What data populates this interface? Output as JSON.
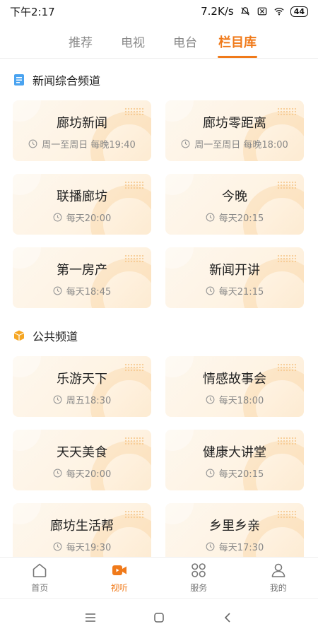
{
  "status_bar": {
    "time": "下午2:17",
    "network_speed": "7.2K/s",
    "battery": "44"
  },
  "top_tabs": [
    {
      "label": "推荐",
      "active": false
    },
    {
      "label": "电视",
      "active": false
    },
    {
      "label": "电台",
      "active": false
    },
    {
      "label": "栏目库",
      "active": true
    }
  ],
  "sections": [
    {
      "title": "新闻综合频道",
      "icon": "document-icon",
      "programs": [
        {
          "name": "廊坊新闻",
          "schedule": "周一至周日 每晚19:40"
        },
        {
          "name": "廊坊零距离",
          "schedule": "周一至周日 每晚18:00"
        },
        {
          "name": "联播廊坊",
          "schedule": "每天20:00"
        },
        {
          "name": "今晚",
          "schedule": "每天20:15"
        },
        {
          "name": "第一房产",
          "schedule": "每天18:45"
        },
        {
          "name": "新闻开讲",
          "schedule": "每天21:15"
        }
      ]
    },
    {
      "title": "公共频道",
      "icon": "box-icon",
      "programs": [
        {
          "name": "乐游天下",
          "schedule": "周五18:30"
        },
        {
          "name": "情感故事会",
          "schedule": "每天18:00"
        },
        {
          "name": "天天美食",
          "schedule": "每天20:00"
        },
        {
          "name": "健康大讲堂",
          "schedule": "每天20:15"
        },
        {
          "name": "廊坊生活帮",
          "schedule": "每天19:30"
        },
        {
          "name": "乡里乡亲",
          "schedule": "每天17:30"
        }
      ]
    }
  ],
  "bottom_nav": [
    {
      "label": "首页",
      "icon": "home-icon",
      "active": false
    },
    {
      "label": "视听",
      "icon": "video-camera-icon",
      "active": true
    },
    {
      "label": "服务",
      "icon": "grid-icon",
      "active": false
    },
    {
      "label": "我的",
      "icon": "user-icon",
      "active": false
    }
  ],
  "colors": {
    "accent": "#f07a1a",
    "card_bg": "#fef3e3",
    "muted_text": "#888888"
  }
}
